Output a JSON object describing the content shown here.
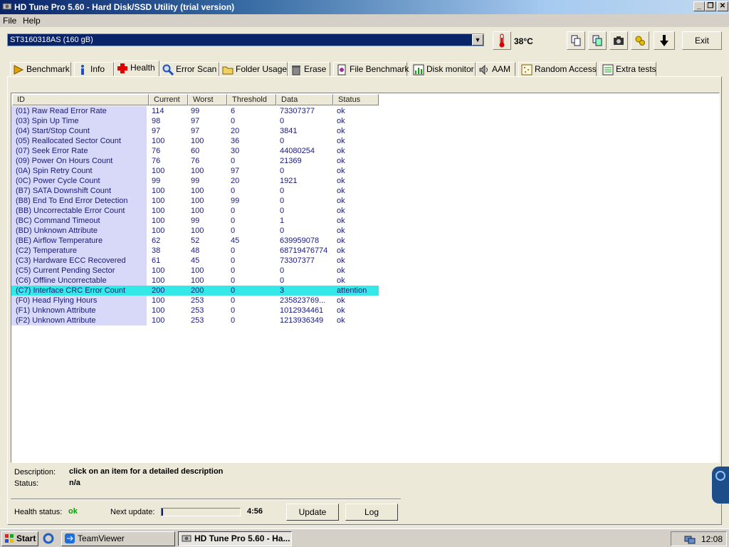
{
  "window": {
    "title": "HD Tune Pro 5.60 - Hard Disk/SSD Utility (trial version)"
  },
  "menu": {
    "file": "File",
    "help": "Help"
  },
  "toolbar": {
    "drive": "ST3160318AS (160 gB)",
    "temperature": "38°C",
    "exit_label": "Exit"
  },
  "tabs": [
    {
      "label": "Benchmark",
      "icon": "benchmark-icon"
    },
    {
      "label": "Info",
      "icon": "info-icon"
    },
    {
      "label": "Health",
      "icon": "health-cross-icon"
    },
    {
      "label": "Error Scan",
      "icon": "magnifier-icon"
    },
    {
      "label": "Folder Usage",
      "icon": "folder-icon"
    },
    {
      "label": "Erase",
      "icon": "trash-icon"
    },
    {
      "label": "File Benchmark",
      "icon": "file-benchmark-icon"
    },
    {
      "label": "Disk monitor",
      "icon": "disk-monitor-icon"
    },
    {
      "label": "AAM",
      "icon": "speaker-icon"
    },
    {
      "label": "Random Access",
      "icon": "random-access-icon"
    },
    {
      "label": "Extra tests",
      "icon": "extra-tests-icon"
    }
  ],
  "columns": [
    "ID",
    "Current",
    "Worst",
    "Threshold",
    "Data",
    "Status"
  ],
  "rows": [
    [
      "(01) Raw Read Error Rate",
      "114",
      "99",
      "6",
      "73307377",
      "ok"
    ],
    [
      "(03) Spin Up Time",
      "98",
      "97",
      "0",
      "0",
      "ok"
    ],
    [
      "(04) Start/Stop Count",
      "97",
      "97",
      "20",
      "3841",
      "ok"
    ],
    [
      "(05) Reallocated Sector Count",
      "100",
      "100",
      "36",
      "0",
      "ok"
    ],
    [
      "(07) Seek Error Rate",
      "76",
      "60",
      "30",
      "44080254",
      "ok"
    ],
    [
      "(09) Power On Hours Count",
      "76",
      "76",
      "0",
      "21369",
      "ok"
    ],
    [
      "(0A) Spin Retry Count",
      "100",
      "100",
      "97",
      "0",
      "ok"
    ],
    [
      "(0C) Power Cycle Count",
      "99",
      "99",
      "20",
      "1921",
      "ok"
    ],
    [
      "(B7) SATA Downshift Count",
      "100",
      "100",
      "0",
      "0",
      "ok"
    ],
    [
      "(B8) End To End Error Detection",
      "100",
      "100",
      "99",
      "0",
      "ok"
    ],
    [
      "(BB) Uncorrectable Error Count",
      "100",
      "100",
      "0",
      "0",
      "ok"
    ],
    [
      "(BC) Command Timeout",
      "100",
      "99",
      "0",
      "1",
      "ok"
    ],
    [
      "(BD) Unknown Attribute",
      "100",
      "100",
      "0",
      "0",
      "ok"
    ],
    [
      "(BE) Airflow Temperature",
      "62",
      "52",
      "45",
      "639959078",
      "ok"
    ],
    [
      "(C2) Temperature",
      "38",
      "48",
      "0",
      "68719476774",
      "ok"
    ],
    [
      "(C3) Hardware ECC Recovered",
      "61",
      "45",
      "0",
      "73307377",
      "ok"
    ],
    [
      "(C5) Current Pending Sector",
      "100",
      "100",
      "0",
      "0",
      "ok"
    ],
    [
      "(C6) Offline Uncorrectable",
      "100",
      "100",
      "0",
      "0",
      "ok"
    ],
    [
      "(C7) Interface CRC Error Count",
      "200",
      "200",
      "0",
      "3",
      "attention"
    ],
    [
      "(F0) Head Flying Hours",
      "100",
      "253",
      "0",
      "235823769...",
      "ok"
    ],
    [
      "(F1) Unknown Attribute",
      "100",
      "253",
      "0",
      "1012934461",
      "ok"
    ],
    [
      "(F2) Unknown Attribute",
      "100",
      "253",
      "0",
      "1213936349",
      "ok"
    ]
  ],
  "selected_row": 18,
  "details": {
    "description_label": "Description:",
    "description_value": "click on an item for a detailed description",
    "status_label": "Status:",
    "status_value": "n/a"
  },
  "footer": {
    "health_label": "Health status:",
    "health_value": "ok",
    "next_update_label": "Next update:",
    "countdown": "4:56",
    "progress": 0.02,
    "update_label": "Update",
    "log_label": "Log"
  },
  "taskbar": {
    "start": "Start",
    "teamviewer": "TeamViewer",
    "hdtune": "HD Tune Pro 5.60 - Ha...",
    "clock": "12:08"
  },
  "colors": {
    "selected_row": "#34E8E8",
    "id_column": "#D8D8F8",
    "health_ok": "#00A000"
  }
}
